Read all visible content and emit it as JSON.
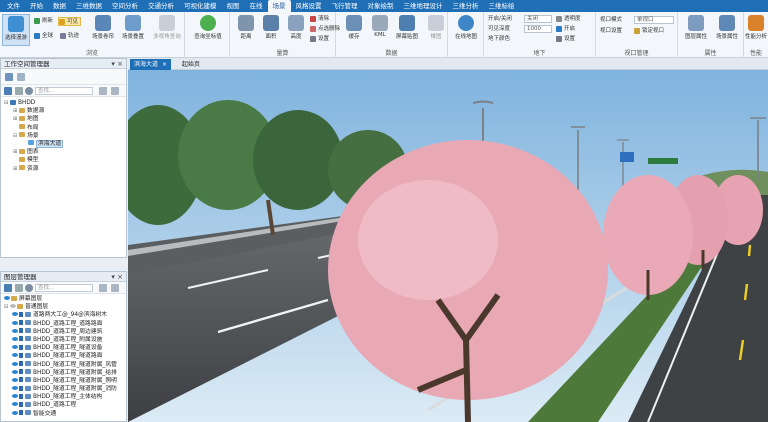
{
  "menubar": {
    "tabs": [
      "文件",
      "开始",
      "数据",
      "三维数据",
      "空间分析",
      "交通分析",
      "可视化建模",
      "视图",
      "在线",
      "场景",
      "风格设置",
      "飞行管理",
      "对象绘制",
      "三维地理设计",
      "三维分析",
      "三维标绘"
    ],
    "active_tab": "场景"
  },
  "ribbon": {
    "browse": {
      "label": "浏览",
      "select_roam": "选择漫游",
      "refresh": "刷新",
      "visible": "可见",
      "globe": "全球",
      "track": "轨迹",
      "scene_curtain": "场景卷帘",
      "scene_overlap": "场景叠置",
      "multi_view_query": "多视角查询"
    },
    "terrain": {
      "label": "",
      "query_coordinate": "查询坐标值"
    },
    "measure": {
      "label": "量算",
      "distance": "距离",
      "area": "面积",
      "height": "高度",
      "clear": "清除",
      "clear_point": "点选删除",
      "settings": "设置"
    },
    "data": {
      "label": "数据",
      "cache": "缓存",
      "kml": "KML",
      "screen_capture": "屏幕贴图",
      "building_map": "楼图"
    },
    "online": {
      "online_map": "在线地图"
    },
    "underground": {
      "label": "地下",
      "open_close": "开启/关闭",
      "visible_depth": "可见深度",
      "underground_color": "地下颜色",
      "transparency_value": "关闭",
      "depth_value": "1000"
    },
    "camera": {
      "transparency": "透明度",
      "open": "开启",
      "settings": "设置"
    },
    "view_window": {
      "label": "视口管理",
      "mode": "视口模式",
      "mode_value": "单视口",
      "settings": "视口设置",
      "lock": "锁定视口"
    },
    "attributes": {
      "label": "属性",
      "layer_attr": "图层属性",
      "scene_attr": "场景属性"
    },
    "performance": {
      "label": "性能",
      "performance_analysis": "性能分析"
    }
  },
  "workspace": {
    "title": "工作空间管理器",
    "search_placeholder": "查找...",
    "tree": [
      {
        "label": "BHDD",
        "indent": 0,
        "toggle": "⊟"
      },
      {
        "label": "数据源",
        "indent": 1,
        "toggle": "⊞"
      },
      {
        "label": "地图",
        "indent": 1,
        "toggle": "⊞"
      },
      {
        "label": "布局",
        "indent": 1,
        "toggle": ""
      },
      {
        "label": "场景",
        "indent": 1,
        "toggle": "⊟"
      },
      {
        "label": "滨海大道",
        "indent": 2,
        "toggle": "",
        "selected": true
      },
      {
        "label": "图表",
        "indent": 1,
        "toggle": "⊞"
      },
      {
        "label": "模型",
        "indent": 1,
        "toggle": ""
      },
      {
        "label": "资源",
        "indent": 1,
        "toggle": "⊞"
      }
    ]
  },
  "layers": {
    "title": "图层管理器",
    "search_placeholder": "查找...",
    "items": [
      {
        "label": "屏幕图层",
        "indent": 0,
        "toggle": "",
        "eye": true
      },
      {
        "label": "普通图层",
        "indent": 0,
        "toggle": "⊟",
        "eye": false
      },
      {
        "label": "道路两大工@_94@滨海树木",
        "indent": 1,
        "eye": true
      },
      {
        "label": "BHDD_道路工程_道路路面",
        "indent": 1,
        "eye": true
      },
      {
        "label": "BHDD_道路工程_周边建筑",
        "indent": 1,
        "eye": true
      },
      {
        "label": "BHDD_道路工程_附属设施",
        "indent": 1,
        "eye": true
      },
      {
        "label": "BHDD_隧道工程_隧道设备",
        "indent": 1,
        "eye": true
      },
      {
        "label": "BHDD_隧道工程_隧道路面",
        "indent": 1,
        "eye": true
      },
      {
        "label": "BHDD_隧道工程_隧道附属_风管",
        "indent": 1,
        "eye": true
      },
      {
        "label": "BHDD_隧道工程_隧道附属_给排",
        "indent": 1,
        "eye": true
      },
      {
        "label": "BHDD_隧道工程_隧道附属_照明",
        "indent": 1,
        "eye": true
      },
      {
        "label": "BHDD_隧道工程_隧道附属_消防",
        "indent": 1,
        "eye": true
      },
      {
        "label": "BHDD_隧道工程_主体结构",
        "indent": 1,
        "eye": true
      },
      {
        "label": "BHDD_道路工程",
        "indent": 1,
        "eye": true
      },
      {
        "label": "智能交通",
        "indent": 1,
        "eye": true
      }
    ]
  },
  "doctabs": {
    "tabs": [
      {
        "label": "滨海大道",
        "active": true
      },
      {
        "label": "起始页",
        "active": false
      }
    ],
    "close_glyph": "×"
  },
  "colors": {
    "accent": "#1f6fb7",
    "sky": "#8ec0e6",
    "road": "#4a4c4f",
    "blossom": "#e8a8b4",
    "foliage": "#3e6b3c"
  }
}
